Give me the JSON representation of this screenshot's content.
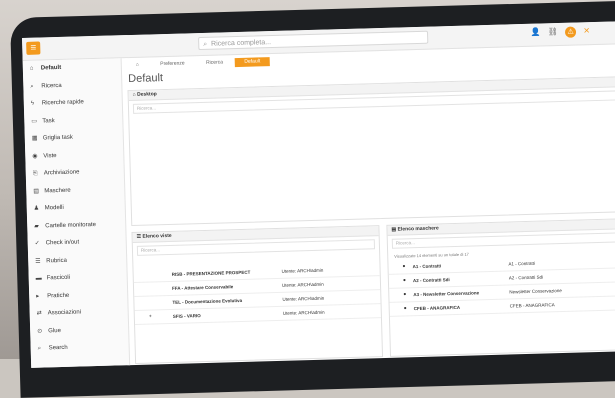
{
  "topbar": {
    "search_placeholder": "Ricerca completa...",
    "icons": [
      "user-icon",
      "link-icon",
      "bell-icon",
      "tools-icon"
    ]
  },
  "sidebar": {
    "items": [
      {
        "label": "Default",
        "icon": "home-icon"
      },
      {
        "label": "Ricerca",
        "icon": "search-icon"
      },
      {
        "label": "Ricerche rapide",
        "icon": "bolt-icon"
      },
      {
        "label": "Task",
        "icon": "task-icon"
      },
      {
        "label": "Griglia task",
        "icon": "grid-icon"
      },
      {
        "label": "Viste",
        "icon": "eye-icon"
      },
      {
        "label": "Archiviazione",
        "icon": "archive-icon"
      },
      {
        "label": "Maschere",
        "icon": "form-icon"
      },
      {
        "label": "Modelli",
        "icon": "model-icon"
      },
      {
        "label": "Cartelle monitorate",
        "icon": "folder-icon"
      },
      {
        "label": "Check in/out",
        "icon": "check-icon"
      },
      {
        "label": "Rubrica",
        "icon": "book-icon"
      },
      {
        "label": "Fascicoli",
        "icon": "fascicle-icon"
      },
      {
        "label": "Pratiche",
        "icon": "case-icon"
      },
      {
        "label": "Associazioni",
        "icon": "association-icon"
      },
      {
        "label": "Glue",
        "icon": "glue-icon"
      },
      {
        "label": "Search",
        "icon": "search-icon"
      }
    ]
  },
  "tabs": [
    {
      "label": "Preferenze"
    },
    {
      "label": "Ricerca"
    },
    {
      "label": "Default",
      "active": true
    }
  ],
  "page_title": "Default",
  "desktop_panel": {
    "title": "Desktop",
    "input_placeholder": "Ricerca..."
  },
  "left_panel": {
    "title": "Elenco viste",
    "input_placeholder": "Ricerca...",
    "rows": [
      {
        "name": "RISB - PRESENTAZIONE PROSPECT",
        "owner": "Utente: ARCH\\admin"
      },
      {
        "name": "FFA - Attestare Conservabile",
        "owner": "Utente: ARCH\\admin"
      },
      {
        "name": "TEL - Documentazione Evolutiva",
        "owner": "Utente: ARCH\\admin"
      },
      {
        "name": "SFIS - VARIO",
        "owner": "Utente: ARCH\\admin"
      }
    ]
  },
  "right_panel": {
    "title": "Elenco maschere",
    "input_placeholder": "Ricerca...",
    "hint": "Visualizzate 14 elementi su un totale di 17",
    "rows": [
      {
        "name": "A1 - Contratti",
        "value": "A1 - Contratti"
      },
      {
        "name": "A2 - Contratti Sdi",
        "value": "A2 - Contratti Sdi"
      },
      {
        "name": "A3 - Newsletter Conservazione",
        "value": "Newsletter Conservazione"
      },
      {
        "name": "CFEB - ANAGRAFICA",
        "value": "CFEB - ANAGRAFICA"
      }
    ]
  }
}
